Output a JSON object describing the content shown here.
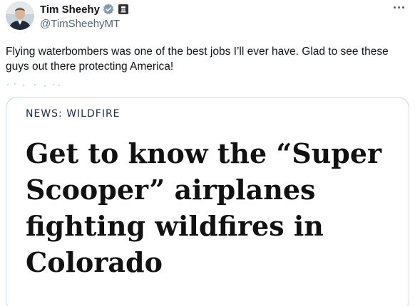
{
  "author": {
    "display_name": "Tim Sheehy",
    "handle": "@TimSheehyMT",
    "avatar_icon": "profile-photo",
    "verified_icon": "verified-badge-icon",
    "affiliation_icon": "government-badge-icon"
  },
  "more_icon": "more-options-icon",
  "tweet": {
    "text": "Flying waterbombers was one of the best jobs I’ll ever have. Glad to see these guys out there protecting America!"
  },
  "link_card": {
    "kicker": "NEWS: WILDFIRE",
    "headline": "Get to know the “Super Scooper” airplanes fighting wildfires in Colorado"
  },
  "colors": {
    "text_primary": "#0f1419",
    "text_secondary": "#536471",
    "card_border": "#cfd9de",
    "kicker": "#1c2a4a"
  }
}
